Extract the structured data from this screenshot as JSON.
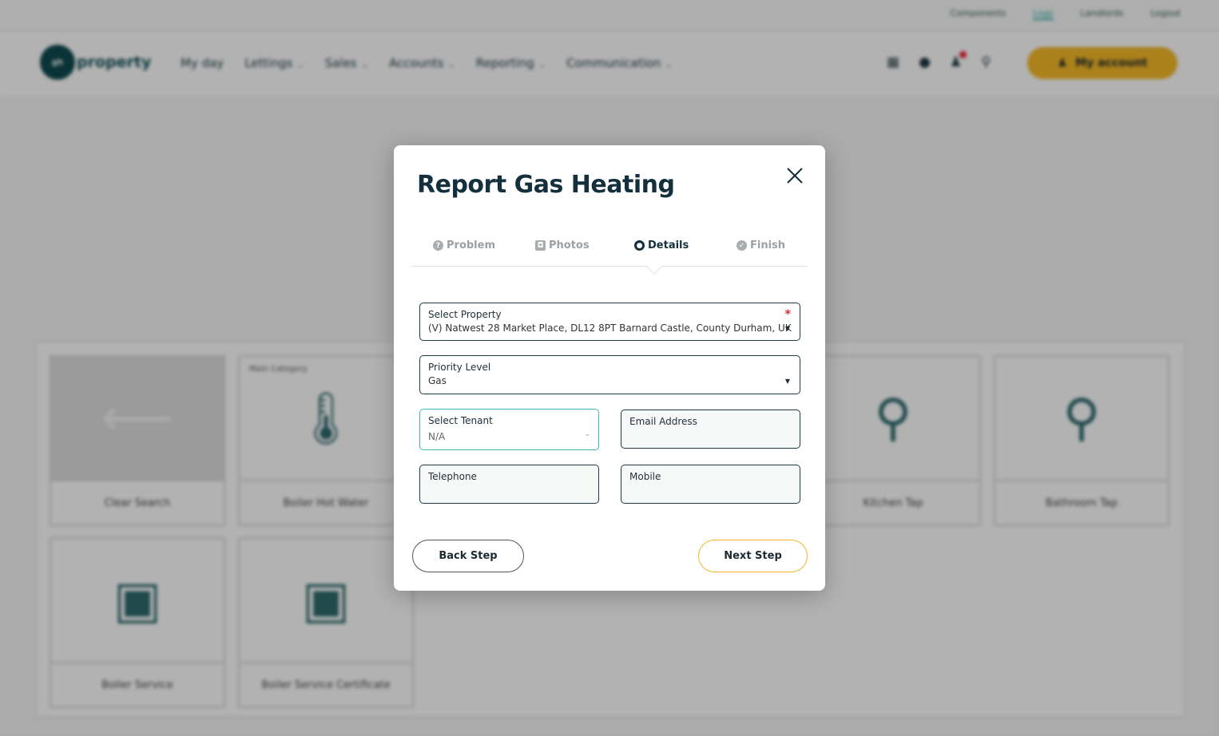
{
  "topbar": {
    "links": [
      "Components",
      "Logs",
      "Landlords",
      "Logout"
    ]
  },
  "nav": {
    "logo_badge": "gh",
    "logo_text": "property",
    "menu": [
      {
        "label": "My day"
      },
      {
        "label": "Lettings"
      },
      {
        "label": "Sales"
      },
      {
        "label": "Accounts"
      },
      {
        "label": "Reporting"
      },
      {
        "label": "Communication"
      }
    ],
    "account_button": "My account"
  },
  "tiles": [
    {
      "label": "Clear Search"
    },
    {
      "label": "Boiler Hot Water",
      "tag": "Main Category"
    },
    {
      "label": "Kitchen Tap"
    },
    {
      "label": "Bathroom Tap"
    },
    {
      "label": "Boiler Service"
    },
    {
      "label": "Boiler Service Certificate"
    }
  ],
  "modal": {
    "title": "Report Gas Heating",
    "steps": [
      {
        "label": "Problem",
        "icon": "question-circle-icon",
        "glyph": "?"
      },
      {
        "label": "Photos",
        "icon": "camera-icon",
        "glyph": "◘"
      },
      {
        "label": "Details",
        "icon": "user-circle-icon",
        "glyph": "●"
      },
      {
        "label": "Finish",
        "icon": "check-circle-icon",
        "glyph": "✓"
      }
    ],
    "active_step": "Details",
    "fields": {
      "property": {
        "label": "Select Property",
        "value": "(V) Natwest 28 Market Place, DL12 8PT Barnard Castle, County Durham, UK",
        "required_mark": "*"
      },
      "priority": {
        "label": "Priority Level",
        "value": "Gas"
      },
      "tenant": {
        "label": "Select Tenant",
        "value": "N/A"
      },
      "email": {
        "label": "Email Address",
        "value": ""
      },
      "telephone": {
        "label": "Telephone",
        "value": ""
      },
      "mobile": {
        "label": "Mobile",
        "value": ""
      }
    },
    "back_button": "Back Step",
    "next_button": "Next Step"
  },
  "colors": {
    "accent_yellow": "#f5b928",
    "focus_teal": "#3fb8b5",
    "dark_navy": "#15303d",
    "required_red": "#e2232b"
  }
}
